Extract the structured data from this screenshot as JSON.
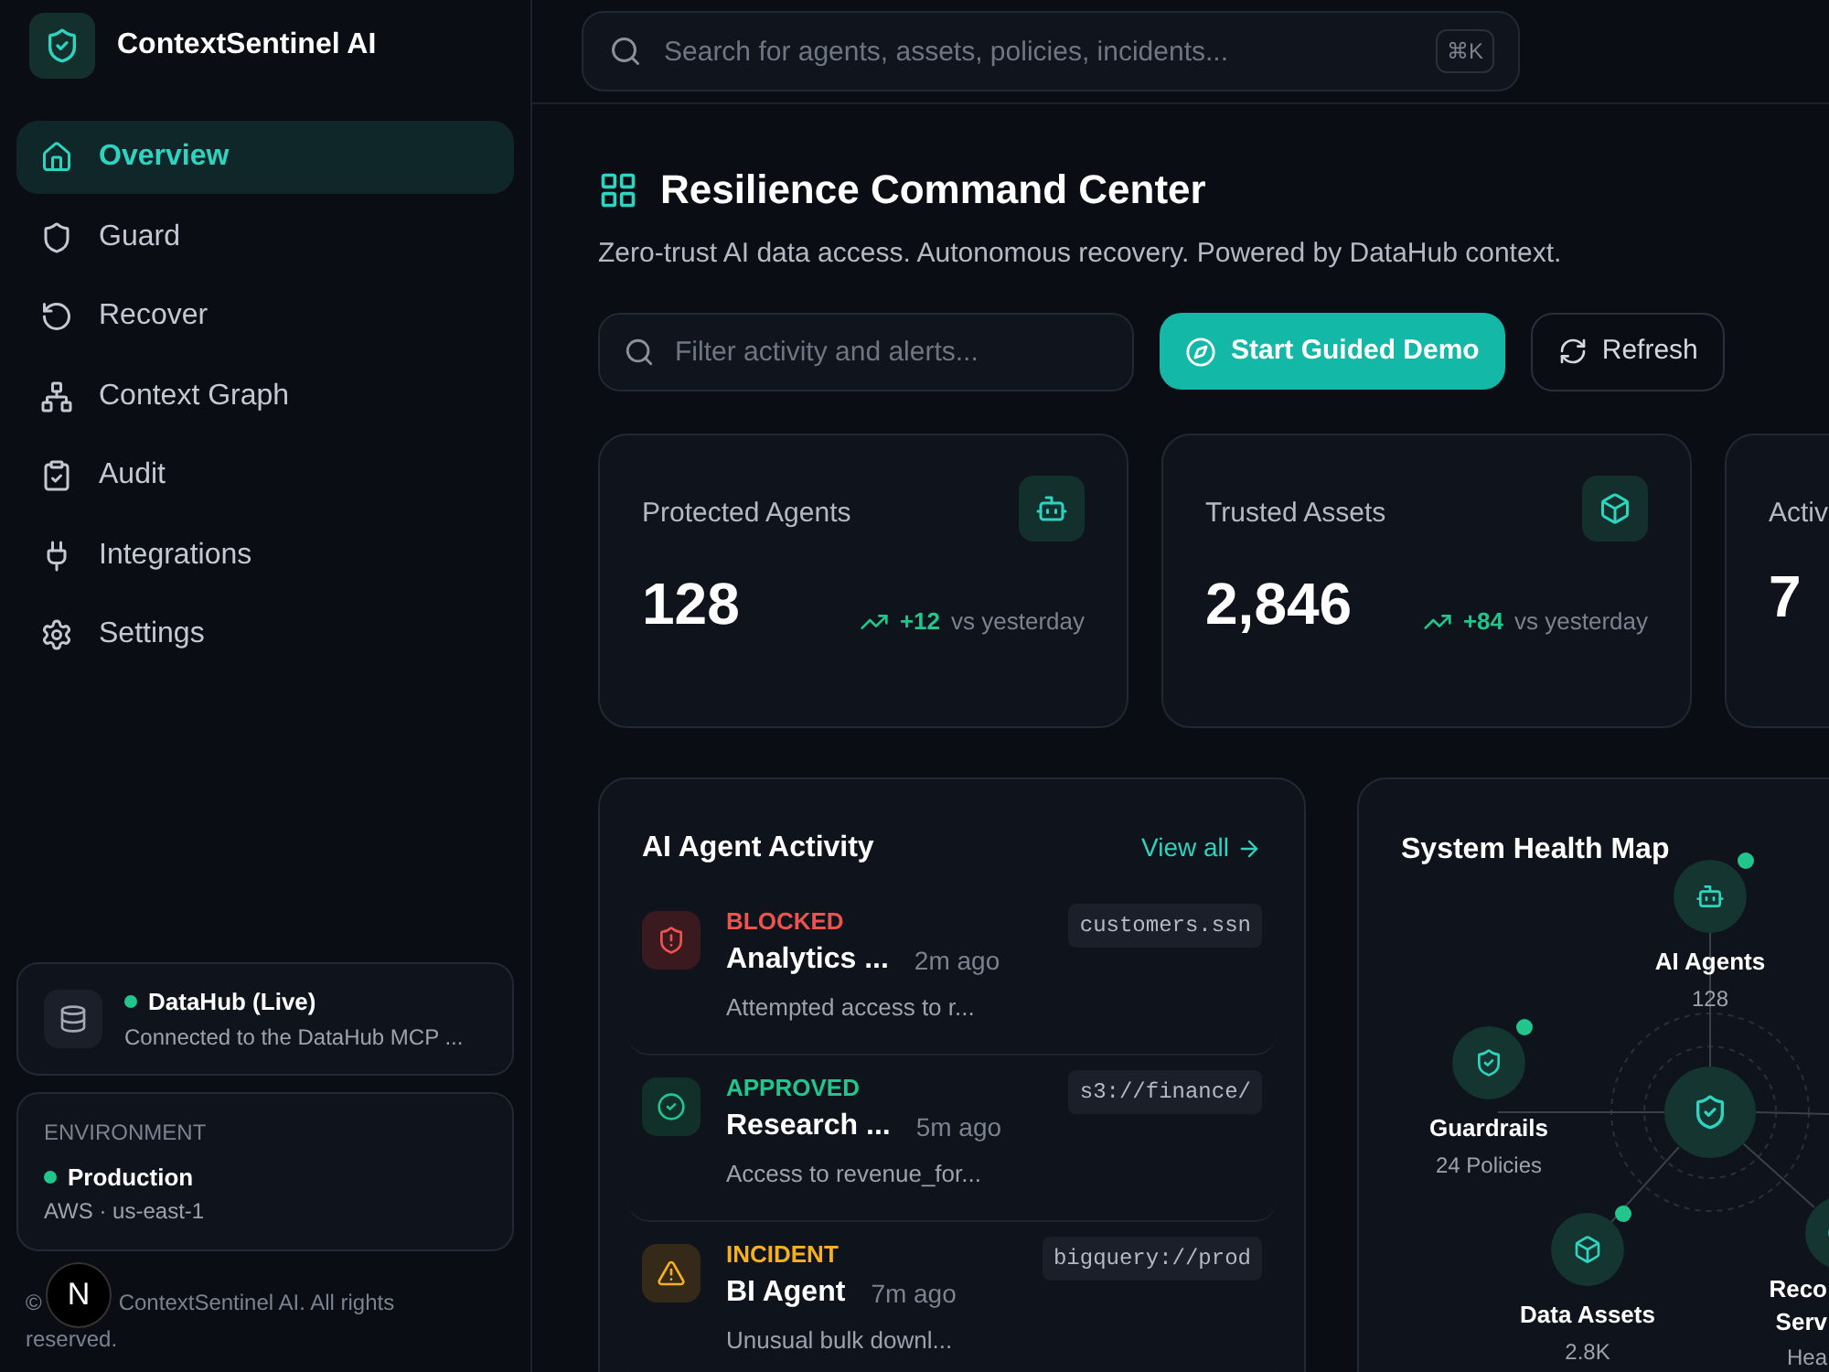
{
  "brand": {
    "name": "ContextSentinel AI"
  },
  "nav": [
    {
      "label": "Overview",
      "selected": true
    },
    {
      "label": "Guard",
      "selected": false
    },
    {
      "label": "Recover",
      "selected": false
    },
    {
      "label": "Context Graph",
      "selected": false
    },
    {
      "label": "Audit",
      "selected": false
    },
    {
      "label": "Integrations",
      "selected": false
    },
    {
      "label": "Settings",
      "selected": false
    }
  ],
  "datahub": {
    "title": "DataHub (Live)",
    "subtitle": "Connected to the DataHub MCP ...",
    "online": true
  },
  "environment": {
    "heading": "ENVIRONMENT",
    "name": "Production",
    "region": "AWS · us-east-1",
    "online": true
  },
  "footer": {
    "prefix": "©",
    "lines": [
      "ContextSentinel AI. All rights",
      "reserved."
    ]
  },
  "dev_badge": "N",
  "search": {
    "placeholder": "Search for agents, assets, policies, incidents...",
    "shortcut": "⌘K"
  },
  "header": {
    "title": "Resilience Command Center",
    "subtitle": "Zero-trust AI data access. Autonomous recovery. Powered by DataHub context."
  },
  "filter": {
    "placeholder": "Filter activity and alerts..."
  },
  "buttons": {
    "primary": "Start Guided Demo",
    "secondary": "Refresh"
  },
  "stats": [
    {
      "label": "Protected Agents",
      "value": "128",
      "delta": "+12",
      "delta_note": "vs yesterday"
    },
    {
      "label": "Trusted Assets",
      "value": "2,846",
      "delta": "+84",
      "delta_note": "vs yesterday"
    },
    {
      "label": "Activ",
      "value": "7"
    }
  ],
  "activity": {
    "title": "AI Agent Activity",
    "link": "View all",
    "rows": [
      {
        "kind": "blocked",
        "status": "BLOCKED",
        "agent": "Analytics ...",
        "time": "2m ago",
        "detail": "Attempted access to r...",
        "resource": "customers.ssn"
      },
      {
        "kind": "approved",
        "status": "APPROVED",
        "agent": "Research ...",
        "time": "5m ago",
        "detail": "Access to revenue_for...",
        "resource": "s3://finance/"
      },
      {
        "kind": "incident",
        "status": "INCIDENT",
        "agent": "BI Agent",
        "time": "7m ago",
        "detail": "Unusual bulk downl...",
        "resource": "bigquery://prod"
      }
    ]
  },
  "health_map": {
    "title": "System Health Map",
    "nodes": [
      {
        "label": [
          "AI Agents"
        ],
        "value": "128",
        "online": true
      },
      {
        "label": [
          "Guardrails"
        ],
        "value": "24 Policies",
        "online": true
      },
      {
        "label": [
          "Data Assets"
        ],
        "value": "2.8K",
        "online": true
      },
      {
        "label": [
          "Reco",
          "Serv"
        ],
        "value": "Hea"
      }
    ]
  }
}
